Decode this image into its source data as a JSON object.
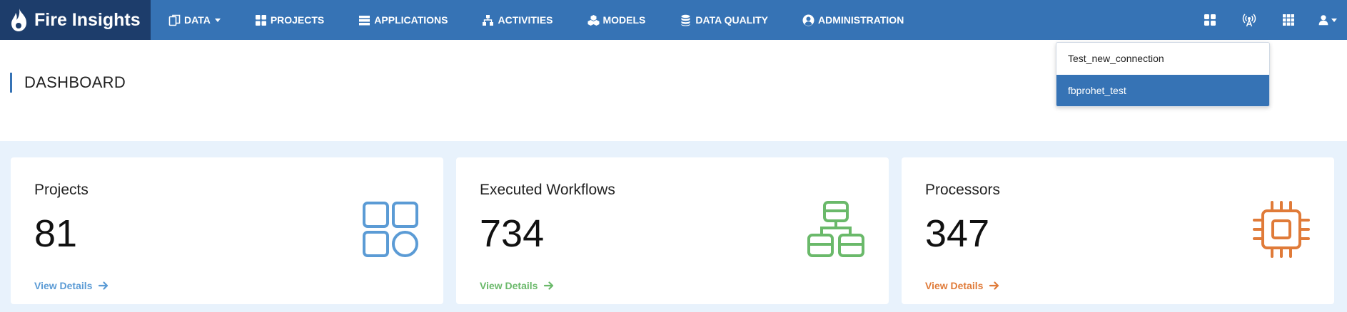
{
  "brand": {
    "name": "Fire Insights"
  },
  "nav": {
    "items": [
      {
        "label": "DATA",
        "icon": "data-icon",
        "has_caret": true
      },
      {
        "label": "PROJECTS",
        "icon": "projects-icon"
      },
      {
        "label": "APPLICATIONS",
        "icon": "applications-icon"
      },
      {
        "label": "ACTIVITIES",
        "icon": "activities-icon"
      },
      {
        "label": "MODELS",
        "icon": "models-icon"
      },
      {
        "label": "DATA QUALITY",
        "icon": "database-icon"
      },
      {
        "label": "ADMINISTRATION",
        "icon": "user-circle-icon"
      }
    ],
    "right_icons": [
      "dashboard-grid-icon",
      "broadcast-icon",
      "apps-grid-icon",
      "user-icon"
    ]
  },
  "page": {
    "title": "DASHBOARD"
  },
  "dropdown": {
    "items": [
      {
        "label": "Test_new_connection",
        "active": false
      },
      {
        "label": "fbprohet_test",
        "active": true
      }
    ]
  },
  "cards": [
    {
      "title": "Projects",
      "value": "81",
      "link": "View Details",
      "color": "#5b9bd5",
      "icon": "projects-shapes-icon"
    },
    {
      "title": "Executed Workflows",
      "value": "734",
      "link": "View Details",
      "color": "#6ab96a",
      "icon": "workflow-sitemap-icon"
    },
    {
      "title": "Processors",
      "value": "347",
      "link": "View Details",
      "color": "#e07b39",
      "icon": "processor-chip-icon"
    }
  ],
  "colors": {
    "navbar": "#3673b5",
    "brand_bg": "#1d3d6b",
    "content_bg": "#e8f2fc"
  }
}
